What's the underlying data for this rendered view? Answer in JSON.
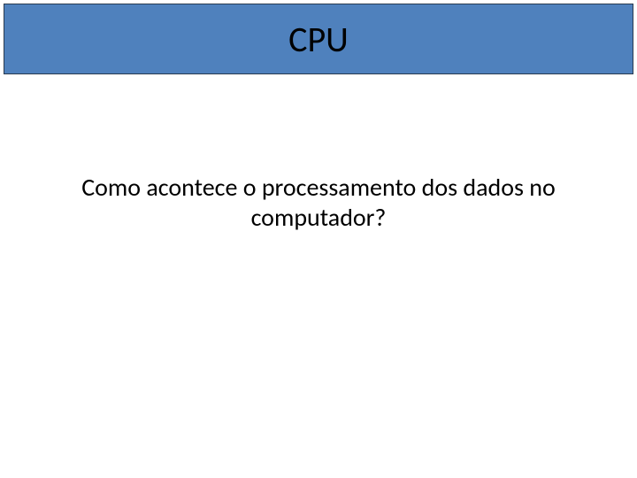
{
  "slide": {
    "title": "CPU",
    "body": "Como acontece o processamento dos dados no computador?"
  }
}
